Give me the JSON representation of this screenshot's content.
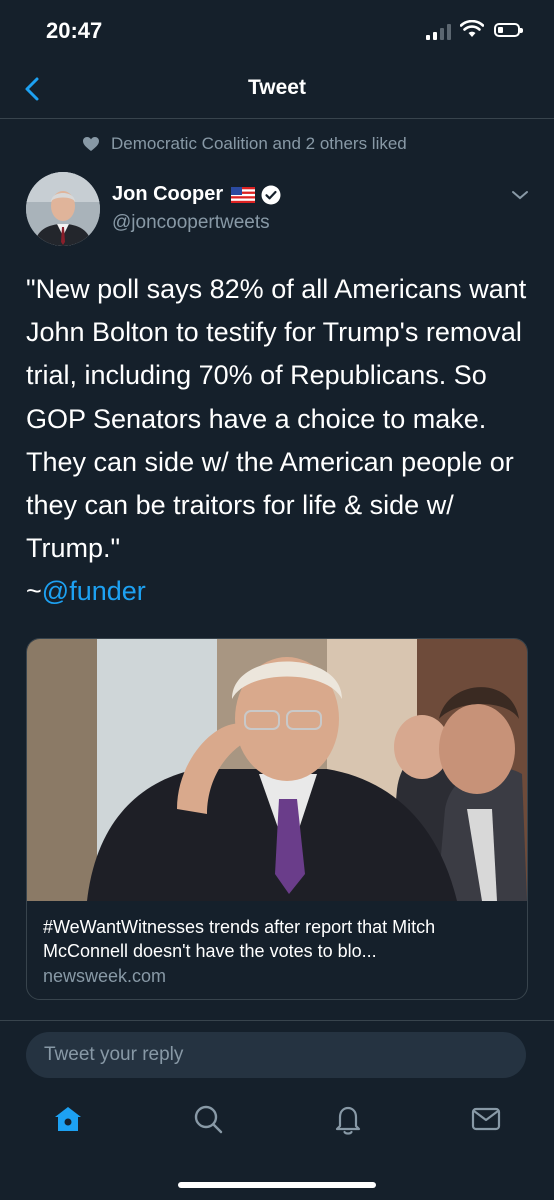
{
  "status_bar": {
    "time": "20:47"
  },
  "header": {
    "title": "Tweet"
  },
  "social_context": {
    "text": "Democratic Coalition and 2 others liked"
  },
  "author": {
    "name": "Jon Cooper",
    "handle": "@joncoopertweets"
  },
  "tweet": {
    "text": "\"New poll says 82% of all Americans want John Bolton to testify for Trump's removal trial, including 70% of Republicans. So GOP Senators have a choice to make. They can side w/ the American people or they can be traitors for life & side w/ Trump.\"",
    "prefix": "~",
    "mention": "@funder"
  },
  "card": {
    "title": "#WeWantWitnesses trends after report that Mitch McConnell doesn't have the votes to blo...",
    "domain": "newsweek.com"
  },
  "reply": {
    "placeholder": "Tweet your reply"
  },
  "tabs": [
    "home-icon",
    "search-icon",
    "notifications-icon",
    "messages-icon"
  ],
  "colors": {
    "background": "#15202b",
    "accent": "#1da1f2",
    "secondary_text": "#8899a6",
    "divider": "#38444d"
  }
}
